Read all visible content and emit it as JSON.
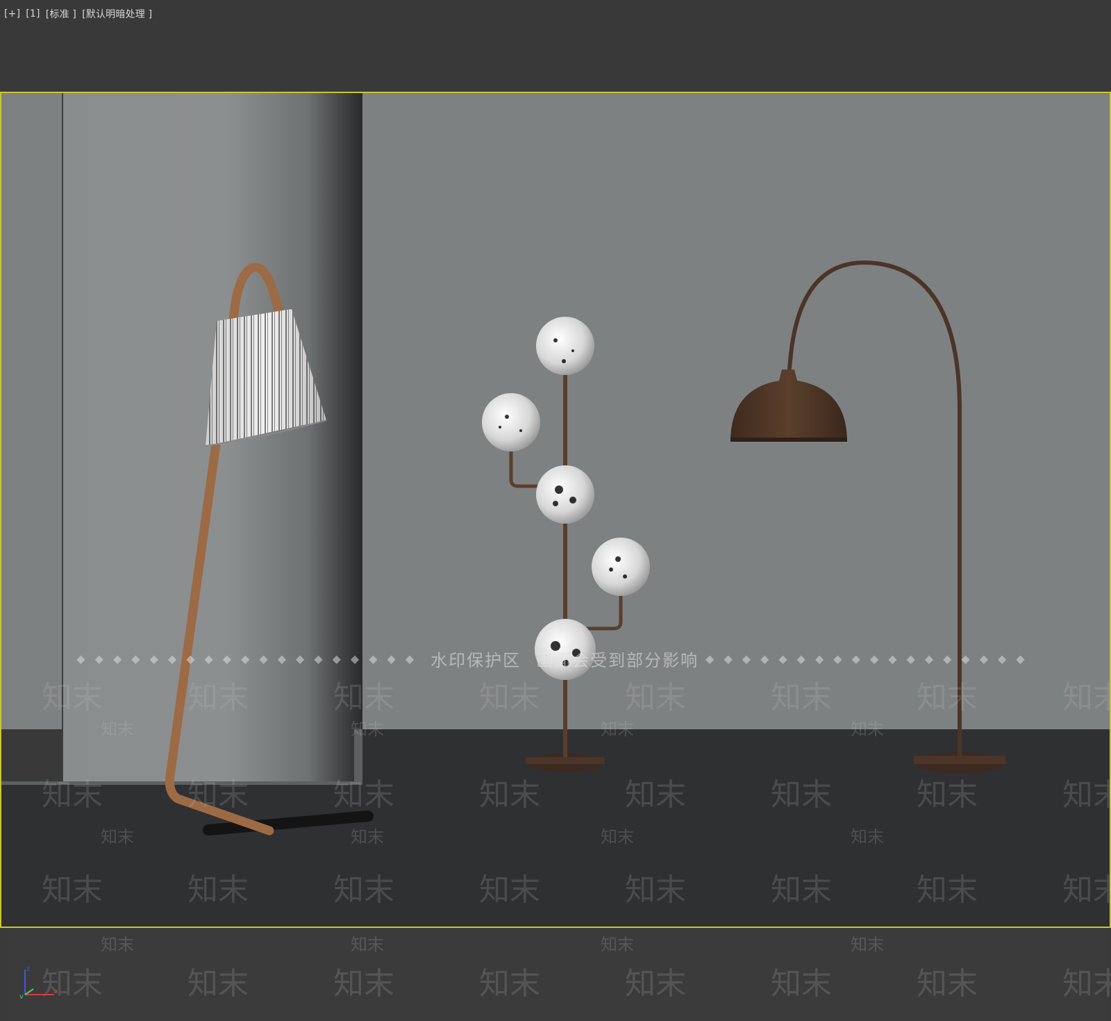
{
  "viewport_menu": {
    "plus": "[+]",
    "view": "[1]",
    "mode": "[标准 ]",
    "shading": "[默认明暗处理 ]"
  },
  "watermark": {
    "banner_left": "水印保护区",
    "banner_right": "画面会受到部分影响",
    "tile_text": "知末"
  },
  "colors": {
    "ui_background": "#393939",
    "safe_frame": "#c9c72a",
    "wall": "#7e8182",
    "floor": "#2f3032",
    "wood": "#9c6a45",
    "metal_brown": "#4a3528"
  },
  "axis_gizmo": {
    "z": "z",
    "x": "x",
    "y": "y"
  }
}
